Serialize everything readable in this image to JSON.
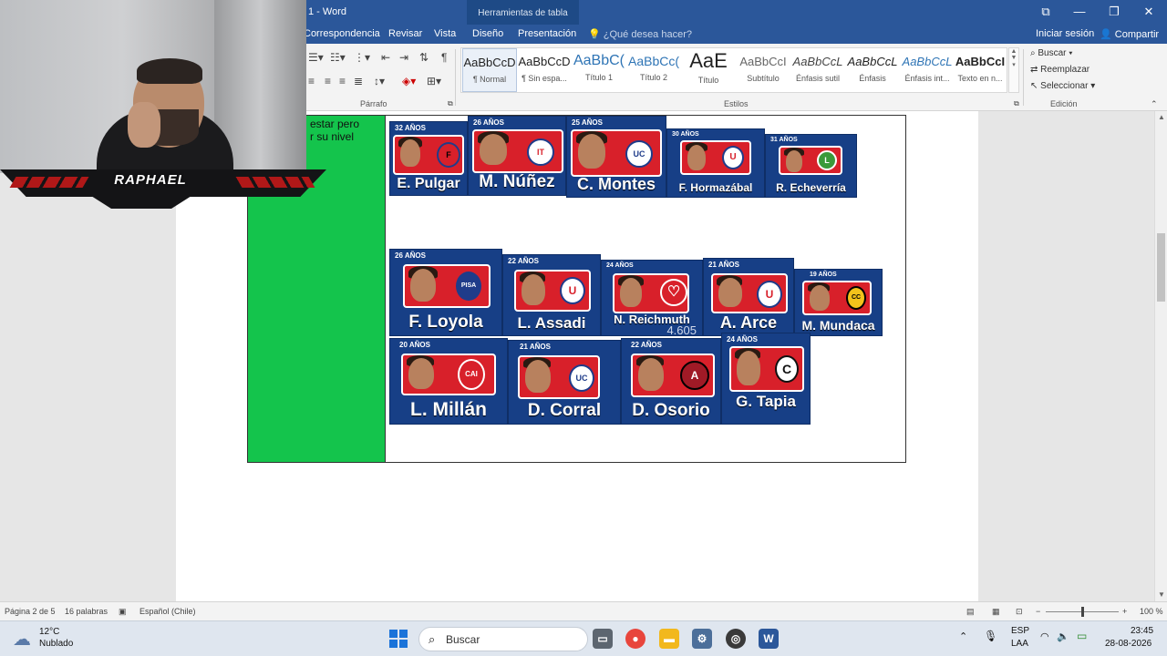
{
  "titlebar": {
    "doc_title": "1 - Word",
    "context_tab": "Herramientas de tabla",
    "window_buttons": [
      "⧉",
      "—",
      "❐",
      "✕"
    ]
  },
  "ribbon_tabs": {
    "tabs": [
      "Correspondencia",
      "Revisar",
      "Vista",
      "Diseño",
      "Presentación"
    ],
    "tell_me": "¿Qué desea hacer?",
    "sign_in": "Iniciar sesión",
    "share": "Compartir"
  },
  "ribbon": {
    "paragraph_label": "Párrafo",
    "styles_label": "Estilos",
    "edit_label": "Edición",
    "styles": [
      {
        "sample": "AaBbCcD",
        "name": "¶ Normal"
      },
      {
        "sample": "AaBbCcD",
        "name": "¶ Sin espa..."
      },
      {
        "sample": "AaBbC(",
        "name": "Título 1"
      },
      {
        "sample": "AaBbCc(",
        "name": "Título 2"
      },
      {
        "sample": "AaE",
        "name": "Título"
      },
      {
        "sample": "AaBbCcI",
        "name": "Subtítulo"
      },
      {
        "sample": "AaBbCcL",
        "name": "Énfasis sutil"
      },
      {
        "sample": "AaBbCcL",
        "name": "Énfasis"
      },
      {
        "sample": "AaBbCcL",
        "name": "Énfasis int..."
      },
      {
        "sample": "AaBbCcI",
        "name": "Texto en n..."
      }
    ],
    "edit_items": [
      "Buscar",
      "Reemplazar",
      "Seleccionar"
    ]
  },
  "document": {
    "green_cell_text": "estar pero\nr su nivel",
    "players": [
      {
        "age": "32 AÑOS",
        "name": "E. Pulgar",
        "crest": "F"
      },
      {
        "age": "26 AÑOS",
        "name": "M. Núñez",
        "crest": "IT"
      },
      {
        "age": "25 AÑOS",
        "name": "C. Montes",
        "crest": "UC"
      },
      {
        "age": "30 AÑOS",
        "name": "F. Hormazábal",
        "crest": "U"
      },
      {
        "age": "31 AÑOS",
        "name": "R. Echeverría",
        "crest": "L"
      },
      {
        "age": "26 AÑOS",
        "name": "F. Loyola",
        "crest": "PISA"
      },
      {
        "age": "22 AÑOS",
        "name": "L. Assadi",
        "crest": "U"
      },
      {
        "age": "24 AÑOS",
        "name": "N. Reichmuth",
        "crest": "♡",
        "extra": "4.605"
      },
      {
        "age": "21 AÑOS",
        "name": "A. Arce",
        "crest": "U"
      },
      {
        "age": "19 AÑOS",
        "name": "M. Mundaca",
        "crest": "CC"
      },
      {
        "age": "20 AÑOS",
        "name": "L. Millán",
        "crest": "CAI"
      },
      {
        "age": "21 AÑOS",
        "name": "D. Corral",
        "crest": "UC"
      },
      {
        "age": "22 AÑOS",
        "name": "D. Osorio",
        "crest": "A"
      },
      {
        "age": "24 AÑOS",
        "name": "G. Tapia",
        "crest": "C"
      }
    ]
  },
  "statusbar": {
    "page": "Página 2 de 5",
    "words": "16 palabras",
    "language": "Español (Chile)",
    "zoom": "100 %"
  },
  "taskbar": {
    "temperature": "12°C",
    "weather": "Nublado",
    "search": "Buscar",
    "lang_top": "ESP",
    "lang_bottom": "LAA",
    "time": "23:45",
    "date": "28-08-2026"
  },
  "webcam": {
    "streamer_name": "RAPHAEL"
  },
  "colors": {
    "word_blue": "#2b579a",
    "green_cell": "#14c44c",
    "card_blue": "#173f86",
    "card_red": "#d8202a"
  }
}
